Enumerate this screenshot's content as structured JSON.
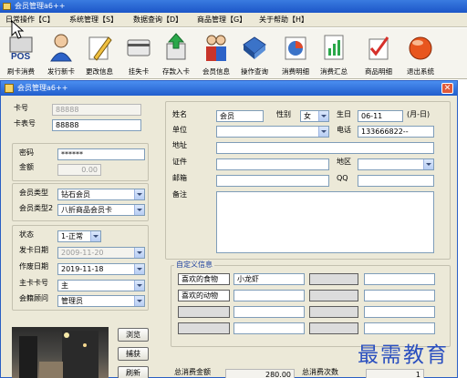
{
  "app": {
    "title": "会员管理a6++",
    "menu": [
      "日常操作【C】",
      "系统管理【S】",
      "数据查询【D】",
      "商品管理【G】",
      "关于帮助【H】"
    ]
  },
  "toolbar": [
    {
      "label": "刷卡消费",
      "icon": "pos-icon"
    },
    {
      "label": "发行新卡",
      "icon": "person-icon"
    },
    {
      "label": "更改信息",
      "icon": "edit-icon"
    },
    {
      "label": "挂失卡",
      "icon": "card-lost-icon"
    },
    {
      "label": "存款入卡",
      "icon": "deposit-icon"
    },
    {
      "label": "会员信息",
      "icon": "members-icon"
    },
    {
      "label": "操作查询",
      "icon": "book-icon"
    },
    {
      "label": "消费明细",
      "icon": "pie-chart-icon"
    },
    {
      "label": "消费汇总",
      "icon": "report-icon"
    },
    {
      "label": "商品明细",
      "icon": "checklist-icon"
    },
    {
      "label": "退出系统",
      "icon": "exit-icon"
    }
  ],
  "dialog": {
    "title": "会员管理a6++",
    "card_no_label": "卡号",
    "card_no_value": "88888",
    "card_table_label": "卡表号",
    "card_table_value": "88888",
    "password_label": "密码",
    "password_value": "******",
    "amount_label": "金额",
    "amount_value": "0.00",
    "member_type_label": "会员类型",
    "member_type_value": "钻石会员",
    "member_type2_label": "会员类型2",
    "member_type2_value": "八折商品会员卡",
    "status_label": "状态",
    "status_value": "1-正常",
    "issue_date_label": "发卡日期",
    "issue_date_value": "2009-11-20",
    "op_date_label": "作废日期",
    "op_date_value": "2019-11-18",
    "main_card_label": "主卡卡号",
    "main_card_value": "主",
    "consultant_label": "会籍顾问",
    "consultant_value": "管理员",
    "name_label": "姓名",
    "name_value": "会员",
    "gender_label": "性别",
    "gender_value": "女",
    "birthday_label": "生日",
    "birthday_value": "06-11",
    "birthday_hint": "(月-日)",
    "unit_label": "单位",
    "phone_label": "电话",
    "phone_value": "133666822--",
    "address_label": "地址",
    "id_label": "证件",
    "region_label": "地区",
    "email_label": "邮箱",
    "qq_label": "QQ",
    "note_label": "备注",
    "custom_group_label": "自定义信息",
    "custom_rows": [
      {
        "key": "喜欢的食物",
        "value": "小龙虾"
      },
      {
        "key": "喜欢的动物",
        "value": ""
      }
    ],
    "browse_btn": "浏览",
    "capture_btn": "捕获",
    "refresh_btn": "刷新",
    "total_amount_label": "总消费金额",
    "total_amount_value": "280.00",
    "total_count_label": "总消费次数",
    "total_count_value": "1"
  },
  "watermark": "最需教育"
}
